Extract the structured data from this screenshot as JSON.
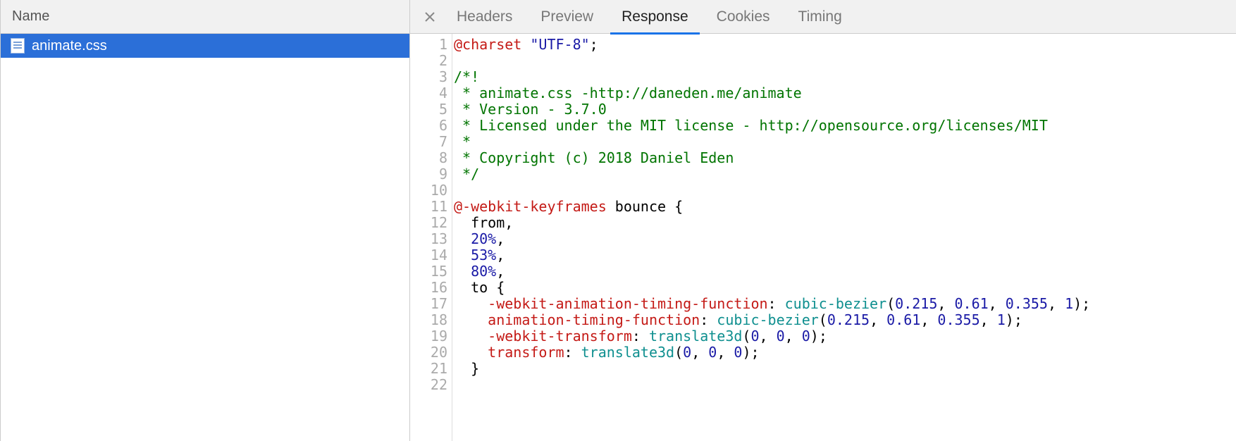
{
  "leftPanel": {
    "header": "Name",
    "files": [
      {
        "name": "animate.css"
      }
    ]
  },
  "tabs": {
    "items": [
      {
        "label": "Headers",
        "active": false
      },
      {
        "label": "Preview",
        "active": false
      },
      {
        "label": "Response",
        "active": true
      },
      {
        "label": "Cookies",
        "active": false
      },
      {
        "label": "Timing",
        "active": false
      }
    ]
  },
  "code": {
    "lines": [
      [
        {
          "t": "@charset",
          "c": "atrule"
        },
        {
          "t": " ",
          "c": "plain"
        },
        {
          "t": "\"UTF-8\"",
          "c": "string"
        },
        {
          "t": ";",
          "c": "punct"
        }
      ],
      [],
      [
        {
          "t": "/*!",
          "c": "comment"
        }
      ],
      [
        {
          "t": " * animate.css -http://daneden.me/animate",
          "c": "comment"
        }
      ],
      [
        {
          "t": " * Version - 3.7.0",
          "c": "comment"
        }
      ],
      [
        {
          "t": " * Licensed under the MIT license - http://opensource.org/licenses/MIT",
          "c": "comment"
        }
      ],
      [
        {
          "t": " *",
          "c": "comment"
        }
      ],
      [
        {
          "t": " * Copyright (c) 2018 Daniel Eden",
          "c": "comment"
        }
      ],
      [
        {
          "t": " */",
          "c": "comment"
        }
      ],
      [],
      [
        {
          "t": "@-webkit-keyframes",
          "c": "atrule"
        },
        {
          "t": " bounce ",
          "c": "plain"
        },
        {
          "t": "{",
          "c": "punct"
        }
      ],
      [
        {
          "t": "  from,",
          "c": "plain"
        }
      ],
      [
        {
          "t": "  ",
          "c": "plain"
        },
        {
          "t": "20%",
          "c": "pct"
        },
        {
          "t": ",",
          "c": "plain"
        }
      ],
      [
        {
          "t": "  ",
          "c": "plain"
        },
        {
          "t": "53%",
          "c": "pct"
        },
        {
          "t": ",",
          "c": "plain"
        }
      ],
      [
        {
          "t": "  ",
          "c": "plain"
        },
        {
          "t": "80%",
          "c": "pct"
        },
        {
          "t": ",",
          "c": "plain"
        }
      ],
      [
        {
          "t": "  to ",
          "c": "plain"
        },
        {
          "t": "{",
          "c": "punct"
        }
      ],
      [
        {
          "t": "    ",
          "c": "plain"
        },
        {
          "t": "-webkit-animation-timing-function",
          "c": "prop"
        },
        {
          "t": ": ",
          "c": "punct"
        },
        {
          "t": "cubic-bezier",
          "c": "value-fn"
        },
        {
          "t": "(",
          "c": "punct"
        },
        {
          "t": "0.215",
          "c": "num"
        },
        {
          "t": ", ",
          "c": "punct"
        },
        {
          "t": "0.61",
          "c": "num"
        },
        {
          "t": ", ",
          "c": "punct"
        },
        {
          "t": "0.355",
          "c": "num"
        },
        {
          "t": ", ",
          "c": "punct"
        },
        {
          "t": "1",
          "c": "num"
        },
        {
          "t": ");",
          "c": "punct"
        }
      ],
      [
        {
          "t": "    ",
          "c": "plain"
        },
        {
          "t": "animation-timing-function",
          "c": "prop"
        },
        {
          "t": ": ",
          "c": "punct"
        },
        {
          "t": "cubic-bezier",
          "c": "value-fn"
        },
        {
          "t": "(",
          "c": "punct"
        },
        {
          "t": "0.215",
          "c": "num"
        },
        {
          "t": ", ",
          "c": "punct"
        },
        {
          "t": "0.61",
          "c": "num"
        },
        {
          "t": ", ",
          "c": "punct"
        },
        {
          "t": "0.355",
          "c": "num"
        },
        {
          "t": ", ",
          "c": "punct"
        },
        {
          "t": "1",
          "c": "num"
        },
        {
          "t": ");",
          "c": "punct"
        }
      ],
      [
        {
          "t": "    ",
          "c": "plain"
        },
        {
          "t": "-webkit-transform",
          "c": "prop"
        },
        {
          "t": ": ",
          "c": "punct"
        },
        {
          "t": "translate3d",
          "c": "value-fn"
        },
        {
          "t": "(",
          "c": "punct"
        },
        {
          "t": "0",
          "c": "num"
        },
        {
          "t": ", ",
          "c": "punct"
        },
        {
          "t": "0",
          "c": "num"
        },
        {
          "t": ", ",
          "c": "punct"
        },
        {
          "t": "0",
          "c": "num"
        },
        {
          "t": ");",
          "c": "punct"
        }
      ],
      [
        {
          "t": "    ",
          "c": "plain"
        },
        {
          "t": "transform",
          "c": "prop"
        },
        {
          "t": ": ",
          "c": "punct"
        },
        {
          "t": "translate3d",
          "c": "value-fn"
        },
        {
          "t": "(",
          "c": "punct"
        },
        {
          "t": "0",
          "c": "num"
        },
        {
          "t": ", ",
          "c": "punct"
        },
        {
          "t": "0",
          "c": "num"
        },
        {
          "t": ", ",
          "c": "punct"
        },
        {
          "t": "0",
          "c": "num"
        },
        {
          "t": ");",
          "c": "punct"
        }
      ],
      [
        {
          "t": "  ",
          "c": "plain"
        },
        {
          "t": "}",
          "c": "punct"
        }
      ],
      []
    ]
  }
}
